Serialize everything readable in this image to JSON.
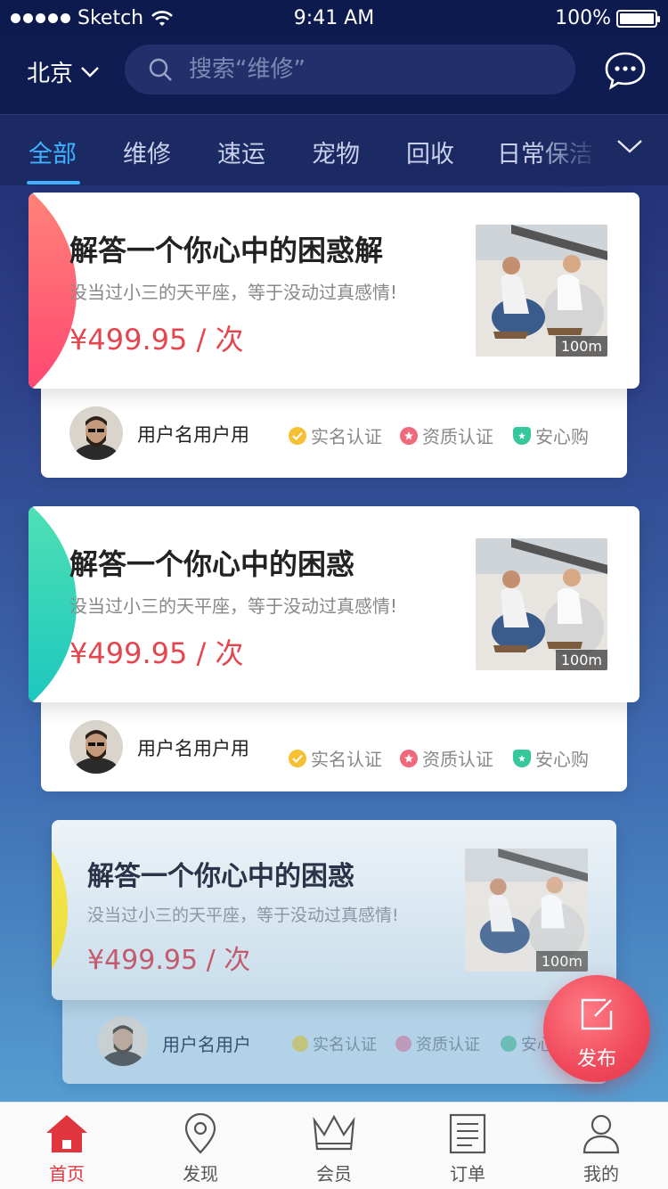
{
  "status_bar": {
    "carrier": "Sketch",
    "time": "9:41 AM",
    "battery": "100%"
  },
  "header": {
    "city": "北京",
    "search_placeholder": "搜索“维修”"
  },
  "tabs": [
    {
      "label": "全部",
      "active": true
    },
    {
      "label": "维修"
    },
    {
      "label": "速运"
    },
    {
      "label": "宠物"
    },
    {
      "label": "回收"
    },
    {
      "label": "日常保洁"
    }
  ],
  "listings": [
    {
      "title": "解答一个你心中的困惑解",
      "subtitle": "没当过小三的天平座，等于没动过真感情!",
      "price": "¥499.95 / 次",
      "distance": "100m",
      "user": "用户名用户用",
      "badges": [
        "实名认证",
        "资质认证",
        "安心购"
      ],
      "accent": "#ff5b74"
    },
    {
      "title": "解答一个你心中的困惑",
      "subtitle": "没当过小三的天平座，等于没动过真感情!",
      "price": "¥499.95 / 次",
      "distance": "100m",
      "user": "用户名用户用",
      "badges": [
        "实名认证",
        "资质认证",
        "安心购"
      ],
      "accent": "#2fd3b5"
    },
    {
      "title": "解答一个你心中的困惑",
      "subtitle": "没当过小三的天平座，等于没动过真感情!",
      "price": "¥499.95 / 次",
      "distance": "100m",
      "user": "用户名用户",
      "badges": [
        "实名认证",
        "资质认证",
        "安心"
      ],
      "accent": "#f3e04a"
    }
  ],
  "fab": {
    "label": "发布"
  },
  "tabbar": [
    {
      "label": "首页",
      "icon": "home-icon",
      "active": true
    },
    {
      "label": "发现",
      "icon": "location-icon"
    },
    {
      "label": "会员",
      "icon": "crown-icon"
    },
    {
      "label": "订单",
      "icon": "order-icon"
    },
    {
      "label": "我的",
      "icon": "user-icon"
    }
  ],
  "colors": {
    "accent_blue": "#3fb2ff",
    "price_red": "#e4464f",
    "fab_red": "#f0495b"
  }
}
